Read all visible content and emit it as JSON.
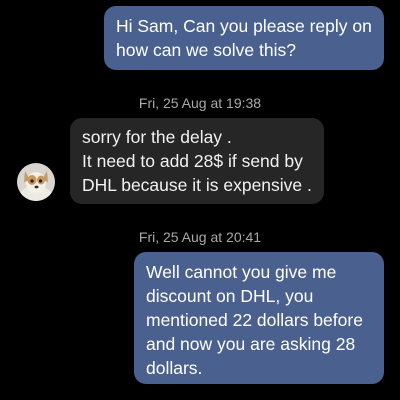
{
  "messages": [
    {
      "direction": "outgoing",
      "text": "Hi Sam, Can you please reply on\nhow can we solve this?"
    },
    {
      "direction": "incoming",
      "text": "sorry for the delay .\nIt need to add 28$ if send by\nDHL because it is expensive ."
    },
    {
      "direction": "outgoing",
      "text": "Well cannot you give me\ndiscount on DHL, you\nmentioned 22 dollars before\nand now you are asking 28\ndollars."
    }
  ],
  "timestamps": [
    "Fri, 25 Aug at 19:38",
    "Fri, 25 Aug at 20:41"
  ],
  "colors": {
    "background": "#000000",
    "outgoing_bubble": "#4a618f",
    "incoming_bubble": "#262626",
    "timestamp_text": "#a9a9a9"
  },
  "avatar": {
    "icon": "dog-avatar-icon"
  }
}
